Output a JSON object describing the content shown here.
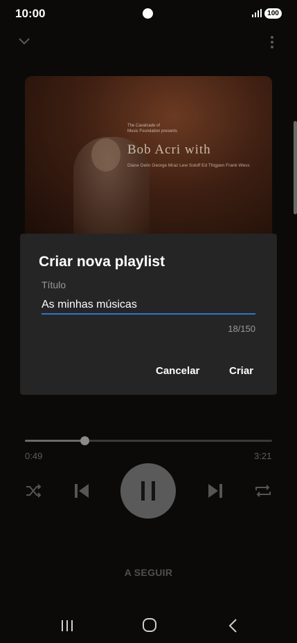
{
  "status_bar": {
    "time": "10:00",
    "battery": "100"
  },
  "album_art": {
    "presenter_line1": "The Cavalcade of",
    "presenter_line2": "Music Foundation presents",
    "artist_text": "Bob Acri with",
    "musicians": "Diane Delin  George Mraz  Lew Soloff  Ed Thigpen  Frank Wess"
  },
  "player": {
    "current_time": "0:49",
    "total_time": "3:21",
    "progress": 0.24,
    "up_next_label": "A SEGUIR"
  },
  "dialog": {
    "title": "Criar nova playlist",
    "field_label": "Título",
    "field_value": "As minhas músicas",
    "counter": "18/150",
    "cancel_label": "Cancelar",
    "create_label": "Criar"
  },
  "icons": {
    "collapse": "chevron-down-icon",
    "more": "more-vert-icon",
    "shuffle": "shuffle-icon",
    "previous": "skip-previous-icon",
    "pause": "pause-icon",
    "next": "skip-next-icon",
    "repeat": "repeat-icon",
    "recents": "recents-icon",
    "home": "home-icon",
    "back": "back-icon"
  },
  "colors": {
    "accent": "#2b78d0",
    "dialog_bg": "#252525",
    "page_bg": "#0b0a09"
  }
}
